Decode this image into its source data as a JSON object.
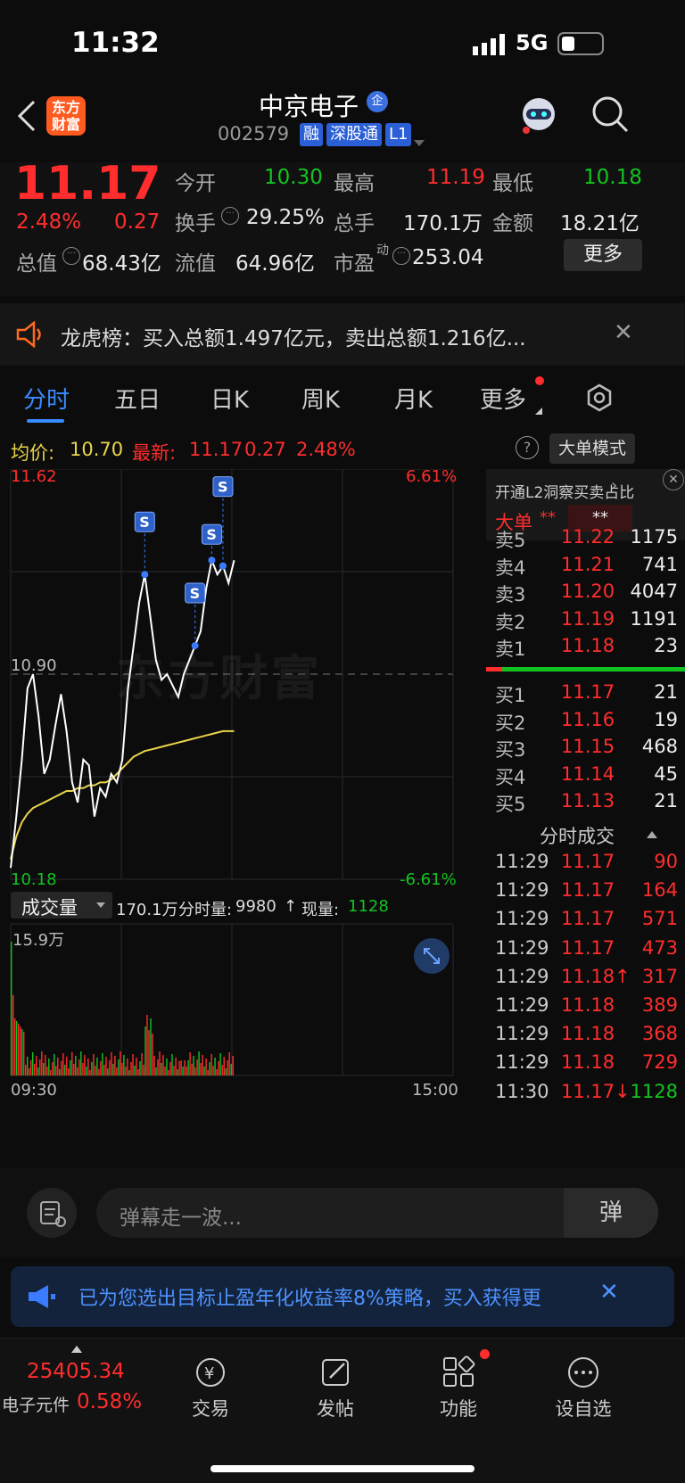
{
  "status": {
    "time": "11:32",
    "network": "5G"
  },
  "header": {
    "logo": "东方\n财富",
    "name": "中京电子",
    "name_badge": "企",
    "code": "002579",
    "tags": [
      "融",
      "深股通",
      "L1"
    ]
  },
  "quote": {
    "price": "11.17",
    "pct": "2.48%",
    "chg": "0.27",
    "row1": [
      {
        "label": "今开",
        "value": "10.30",
        "color": "green"
      },
      {
        "label": "最高",
        "value": "11.19",
        "color": "red"
      },
      {
        "label": "最低",
        "value": "10.18",
        "color": "green"
      }
    ],
    "row2": [
      {
        "label": "换手",
        "value": "29.25%"
      },
      {
        "label": "总手",
        "value": "170.1万"
      },
      {
        "label": "金额",
        "value": "18.21亿"
      }
    ],
    "row3": [
      {
        "label": "总值",
        "value": "68.43亿"
      },
      {
        "label": "流值",
        "value": "64.96亿"
      },
      {
        "label": "市盈",
        "sup": "动",
        "value": "253.04"
      }
    ],
    "more": "更多"
  },
  "notice": {
    "text": "龙虎榜：买入总额1.497亿元，卖出总额1.216亿..."
  },
  "tabs": [
    "分时",
    "五日",
    "日K",
    "周K",
    "月K",
    "更多"
  ],
  "avg": {
    "avg_label": "均价:",
    "avg_value": "10.70",
    "new_label": "最新:",
    "new_value": "11.17",
    "chg": "0.27",
    "pct": "2.48%",
    "mode": "大单模式"
  },
  "chart": {
    "y_top": "11.62",
    "y_mid": "10.90",
    "y_bot": "10.18",
    "pct_top": "6.61%",
    "pct_bot": "-6.61%",
    "s_label": "S",
    "vol_select": "成交量",
    "vol_total": "170.1万",
    "vol_fs_label": "分时量:",
    "vol_fs": "9980",
    "vol_now_label": "现量:",
    "vol_now": "1128",
    "vol_max": "15.9万",
    "t_start": "09:30",
    "t_end": "15:00",
    "watermark": "东方财富"
  },
  "chart_data": {
    "type": "line",
    "x_range": [
      "09:30",
      "15:00"
    ],
    "y_range": [
      10.18,
      11.62
    ],
    "reference": 10.9,
    "series": [
      {
        "values": [
          10.22,
          10.4,
          10.6,
          10.85,
          10.9,
          10.75,
          10.55,
          10.6,
          10.72,
          10.83,
          10.7,
          10.52,
          10.45,
          10.6,
          10.58,
          10.4,
          10.5,
          10.47,
          10.55,
          10.52,
          10.6,
          10.85,
          11.0,
          11.15,
          11.25,
          11.1,
          10.95,
          10.88,
          10.9,
          10.86,
          10.82,
          10.9,
          10.95,
          11.0,
          11.05,
          11.2,
          11.3,
          11.25,
          11.28,
          11.22,
          11.3
        ]
      },
      {
        "values": [
          10.25,
          10.33,
          10.38,
          10.41,
          10.43,
          10.44,
          10.45,
          10.46,
          10.47,
          10.48,
          10.49,
          10.49,
          10.5,
          10.5,
          10.51,
          10.51,
          10.52,
          10.52,
          10.53,
          10.55,
          10.57,
          10.59,
          10.61,
          10.62,
          10.63,
          10.635,
          10.64,
          10.645,
          10.65,
          10.655,
          10.66,
          10.665,
          10.67,
          10.675,
          10.68,
          10.685,
          10.69,
          10.695,
          10.7,
          10.7,
          10.7
        ]
      }
    ]
  },
  "side": {
    "promo": "开通L2洞察买卖占比",
    "big": "大单",
    "stars": "**",
    "stars2": "**",
    "sells": [
      {
        "l": "卖5",
        "p": "11.22",
        "v": "1175"
      },
      {
        "l": "卖4",
        "p": "11.21",
        "v": "741"
      },
      {
        "l": "卖3",
        "p": "11.20",
        "v": "4047"
      },
      {
        "l": "卖2",
        "p": "11.19",
        "v": "1191"
      },
      {
        "l": "卖1",
        "p": "11.18",
        "v": "23"
      }
    ],
    "buys": [
      {
        "l": "买1",
        "p": "11.17",
        "v": "21"
      },
      {
        "l": "买2",
        "p": "11.16",
        "v": "19"
      },
      {
        "l": "买3",
        "p": "11.15",
        "v": "468"
      },
      {
        "l": "买4",
        "p": "11.14",
        "v": "45"
      },
      {
        "l": "买5",
        "p": "11.13",
        "v": "21"
      }
    ],
    "ticks_title": "分时成交",
    "ticks": [
      {
        "t": "11:29",
        "p": "11.17",
        "v": "90"
      },
      {
        "t": "11:29",
        "p": "11.17",
        "v": "164"
      },
      {
        "t": "11:29",
        "p": "11.17",
        "v": "571"
      },
      {
        "t": "11:29",
        "p": "11.17",
        "v": "473"
      },
      {
        "t": "11:29",
        "p": "11.18↑",
        "v": "317"
      },
      {
        "t": "11:29",
        "p": "11.18",
        "v": "389"
      },
      {
        "t": "11:29",
        "p": "11.18",
        "v": "368"
      },
      {
        "t": "11:29",
        "p": "11.18",
        "v": "729"
      },
      {
        "t": "11:30",
        "p": "11.17↓",
        "v": "1128",
        "vg": true
      }
    ]
  },
  "danmu": {
    "placeholder": "弹幕走一波...",
    "btn": "弹"
  },
  "promo": {
    "text": "已为您选出目标止盈年化收益率8%策略，买入获得更"
  },
  "nav": {
    "index_value": "25405.34",
    "index_name": "电子元件",
    "index_pct": "0.58%",
    "items": [
      "交易",
      "发帖",
      "功能",
      "设自选"
    ]
  },
  "colors": {
    "up": "#ff2d2d",
    "down": "#13c322",
    "accent": "#3a7bff"
  }
}
